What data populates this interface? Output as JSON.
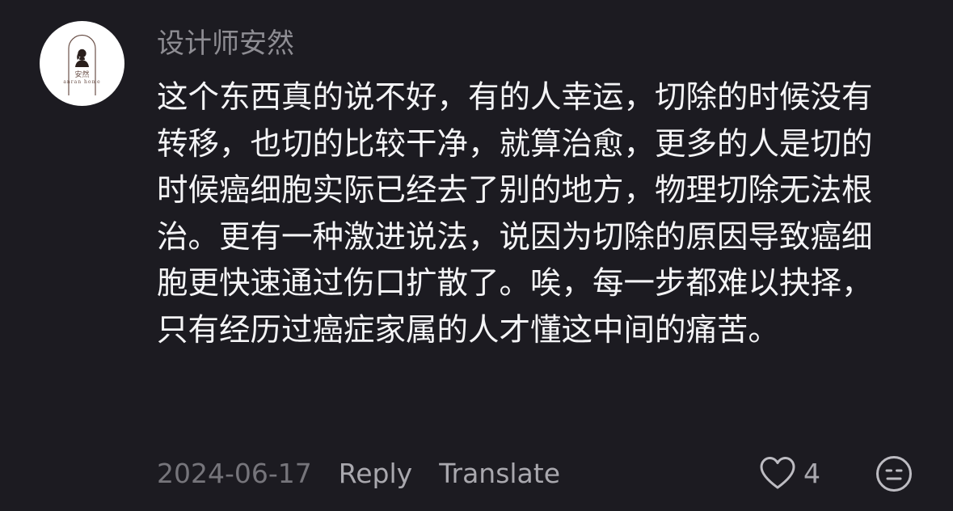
{
  "comment": {
    "avatar": {
      "label_cn": "安然",
      "label_en": "anran home"
    },
    "username": "设计师安然",
    "text": "这个东西真的说不好，有的人幸运，切除的时候没有转移，也切的比较干净，就算治愈，更多的人是切的时候癌细胞实际已经去了别的地方，物理切除无法根治。更有一种激进说法，说因为切除的原因导致癌细胞更快速通过伤口扩散了。唉，每一步都难以抉择，只有经历过癌症家属的人才懂这中间的痛苦。",
    "date": "2024-06-17",
    "reply_label": "Reply",
    "translate_label": "Translate",
    "like_count": "4",
    "like_icon": "heart-outline-icon",
    "dislike_icon": "neutral-face-icon"
  }
}
